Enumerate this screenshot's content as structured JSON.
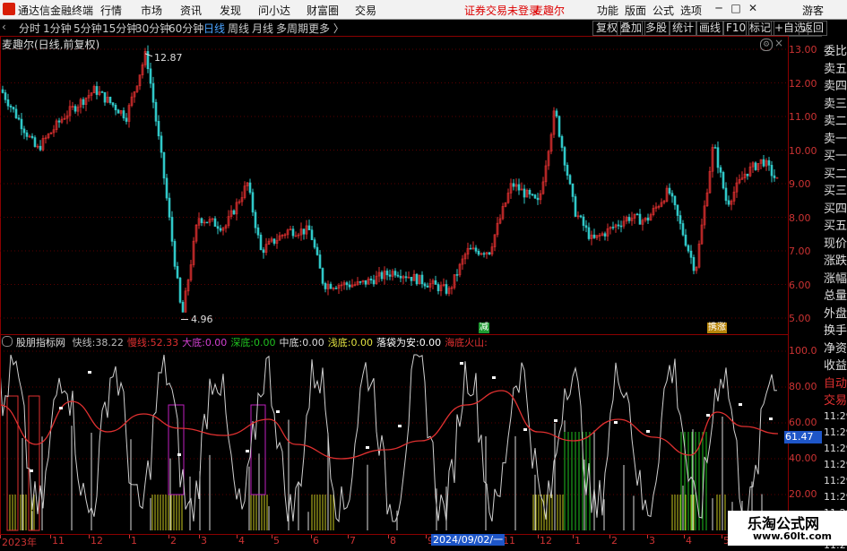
{
  "app": {
    "title": "通达信金融终端",
    "menus": [
      "行情",
      "市场",
      "资讯",
      "发现",
      "问小达",
      "财富圈",
      "交易"
    ],
    "notice": "证券交易未登录",
    "stock_tag": "麦趣尔",
    "right_menus": [
      "功能",
      "版面",
      "公式",
      "选项"
    ],
    "user": "游客",
    "win_buttons": [
      "─",
      "□",
      "✕"
    ]
  },
  "toolbar": {
    "timeframes": [
      "分时",
      "1分钟",
      "5分钟",
      "15分钟",
      "30分钟",
      "60分钟",
      "日线",
      "周线",
      "月线",
      "多周期",
      "更多 〉"
    ],
    "active": "日线",
    "buttons": [
      "复权",
      "叠加",
      "多股",
      "统计",
      "画线",
      "F10",
      "标记",
      "+自选",
      "返回"
    ]
  },
  "main_chart": {
    "title": "麦趣尔(日线,前复权)",
    "y_ticks": [
      "13.00",
      "12.00",
      "11.00",
      "10.00",
      "9.00",
      "8.00",
      "7.00",
      "6.00",
      "5.00"
    ],
    "high_label": "12.87",
    "low_label": "4.96",
    "markers": [
      {
        "text": "减",
        "color": "#1f9b33"
      },
      {
        "text": "携涨",
        "color": "#b8860b"
      }
    ]
  },
  "indicator": {
    "name": "股朋指标网",
    "items": [
      {
        "label": "快线:",
        "value": "38.22",
        "color": "#bbbbbb"
      },
      {
        "label": "慢线:",
        "value": "52.33",
        "color": "#e03030"
      },
      {
        "label": "大底:",
        "value": "0.00",
        "color": "#d040d0"
      },
      {
        "label": "深底:",
        "value": "0.00",
        "color": "#20c020"
      },
      {
        "label": "中底:",
        "value": "0.00",
        "color": "#dddddd"
      },
      {
        "label": "浅底:",
        "value": "0.00",
        "color": "#e0e040"
      },
      {
        "label": "落袋为安:",
        "value": "0.00",
        "color": "#ffffff"
      },
      {
        "label": "海底火山:",
        "value": "",
        "color": "#e03030"
      }
    ],
    "y_ticks": [
      "100.0",
      "80.00",
      "60.00",
      "40.00",
      "20.00"
    ],
    "current_value": "61.47"
  },
  "x_axis": {
    "labels": [
      "2023年",
      "11",
      "12",
      "1",
      "2",
      "3",
      "4",
      "5",
      "6",
      "7",
      "8",
      "9",
      "10",
      "11",
      "12",
      "1",
      "2",
      "3",
      "4",
      "5"
    ],
    "cursor_date": "2024/09/02/一"
  },
  "right_panel": {
    "items": [
      "委比",
      "卖五",
      "卖四",
      "卖三",
      "卖二",
      "卖一",
      "买一",
      "买二",
      "买三",
      "买四",
      "买五",
      "现价",
      "涨跌",
      "涨幅",
      "总量",
      "外盘",
      "换手",
      "净资",
      "收益",
      "自动",
      "交易"
    ],
    "times": [
      "11:29",
      "11:29",
      "11:29",
      "11:29",
      "11:29",
      "11:29",
      "11:29",
      "11:29",
      "11:29"
    ]
  },
  "watermark": {
    "line1": "乐淘公式网",
    "line2": "www.60lt.com"
  },
  "colors": {
    "up": "#e03030",
    "down": "#30c8c8",
    "grid": "#8b0000",
    "accent": "#4aa3ff"
  }
}
